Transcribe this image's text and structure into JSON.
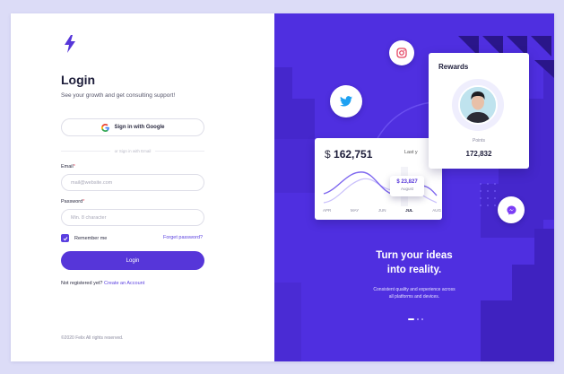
{
  "login": {
    "title": "Login",
    "subtitle": "See your growth and get consulting support!",
    "google_label": "Sign in with Google",
    "divider": "or Sign in with Email",
    "email_label": "Email",
    "email_placeholder": "mail@website.com",
    "password_label": "Password",
    "password_placeholder": "Min. 8 character",
    "remember_label": "Remember me",
    "remember_checked": true,
    "forgot_label": "Forget password?",
    "button_label": "Login",
    "register_prefix": "Not registered yet?",
    "register_link": "Create an Account",
    "copyright": "©2020 Felix All rights reserved."
  },
  "promo": {
    "stat_currency": "$",
    "stat_amount": "162,751",
    "stat_period": "Last y",
    "tooltip_value": "$ 23,827",
    "tooltip_month": "August",
    "months": [
      "APR",
      "MAY",
      "JUN",
      "JUL",
      "AUG"
    ],
    "active_month": "JUL",
    "rewards_title": "Rewards",
    "points_label": "Points",
    "points_value": "172,832",
    "headline_line1": "Turn your ideas",
    "headline_line2": "into reality.",
    "desc_line1": "Consistent quality and experience across",
    "desc_line2": "all platforms and devices.",
    "slides": 3,
    "active_slide": 0
  },
  "icons": {
    "logo": "lightning-bolt-icon",
    "google": "google-g-icon",
    "twitter": "twitter-bird-icon",
    "instagram": "instagram-icon",
    "messenger": "messenger-icon",
    "checkbox": "checkmark-icon"
  },
  "colors": {
    "brand": "#5636d9",
    "promo_bg": "#4f2fe0",
    "accent_link": "#5a3fe0",
    "page_bg": "#dcdcf7"
  }
}
